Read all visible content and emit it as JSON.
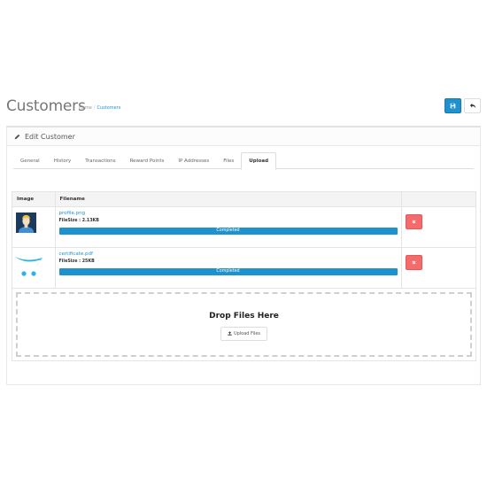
{
  "header": {
    "title": "Customers",
    "breadcrumb": [
      {
        "label": "Home"
      },
      {
        "label": "Customers"
      }
    ],
    "save_icon": "save-icon",
    "back_icon": "reply-icon"
  },
  "panel": {
    "title": "Edit Customer",
    "icon": "pencil-icon"
  },
  "tabs": [
    {
      "label": "General"
    },
    {
      "label": "History"
    },
    {
      "label": "Transactions"
    },
    {
      "label": "Reward Points"
    },
    {
      "label": "IP Addresses"
    },
    {
      "label": "Files"
    },
    {
      "label": "Upload",
      "active": true
    }
  ],
  "table": {
    "columns": [
      "Image",
      "Filename",
      ""
    ],
    "rows": [
      {
        "image": "user-avatar",
        "filename": "profile.png",
        "filesize": "FileSize : 2.13KB",
        "progress": 100,
        "status": "Completed"
      },
      {
        "image": "opencart-logo",
        "filename": "certificate.pdf",
        "filesize": "FileSize : 25KB",
        "progress": 100,
        "status": "Completed"
      }
    ],
    "delete_icon": "times-icon"
  },
  "dropzone": {
    "title": "Drop Files Here",
    "button_label": "Upload Files",
    "button_icon": "upload-icon"
  },
  "colors": {
    "primary": "#1e91cf",
    "danger": "#f56b6b"
  }
}
